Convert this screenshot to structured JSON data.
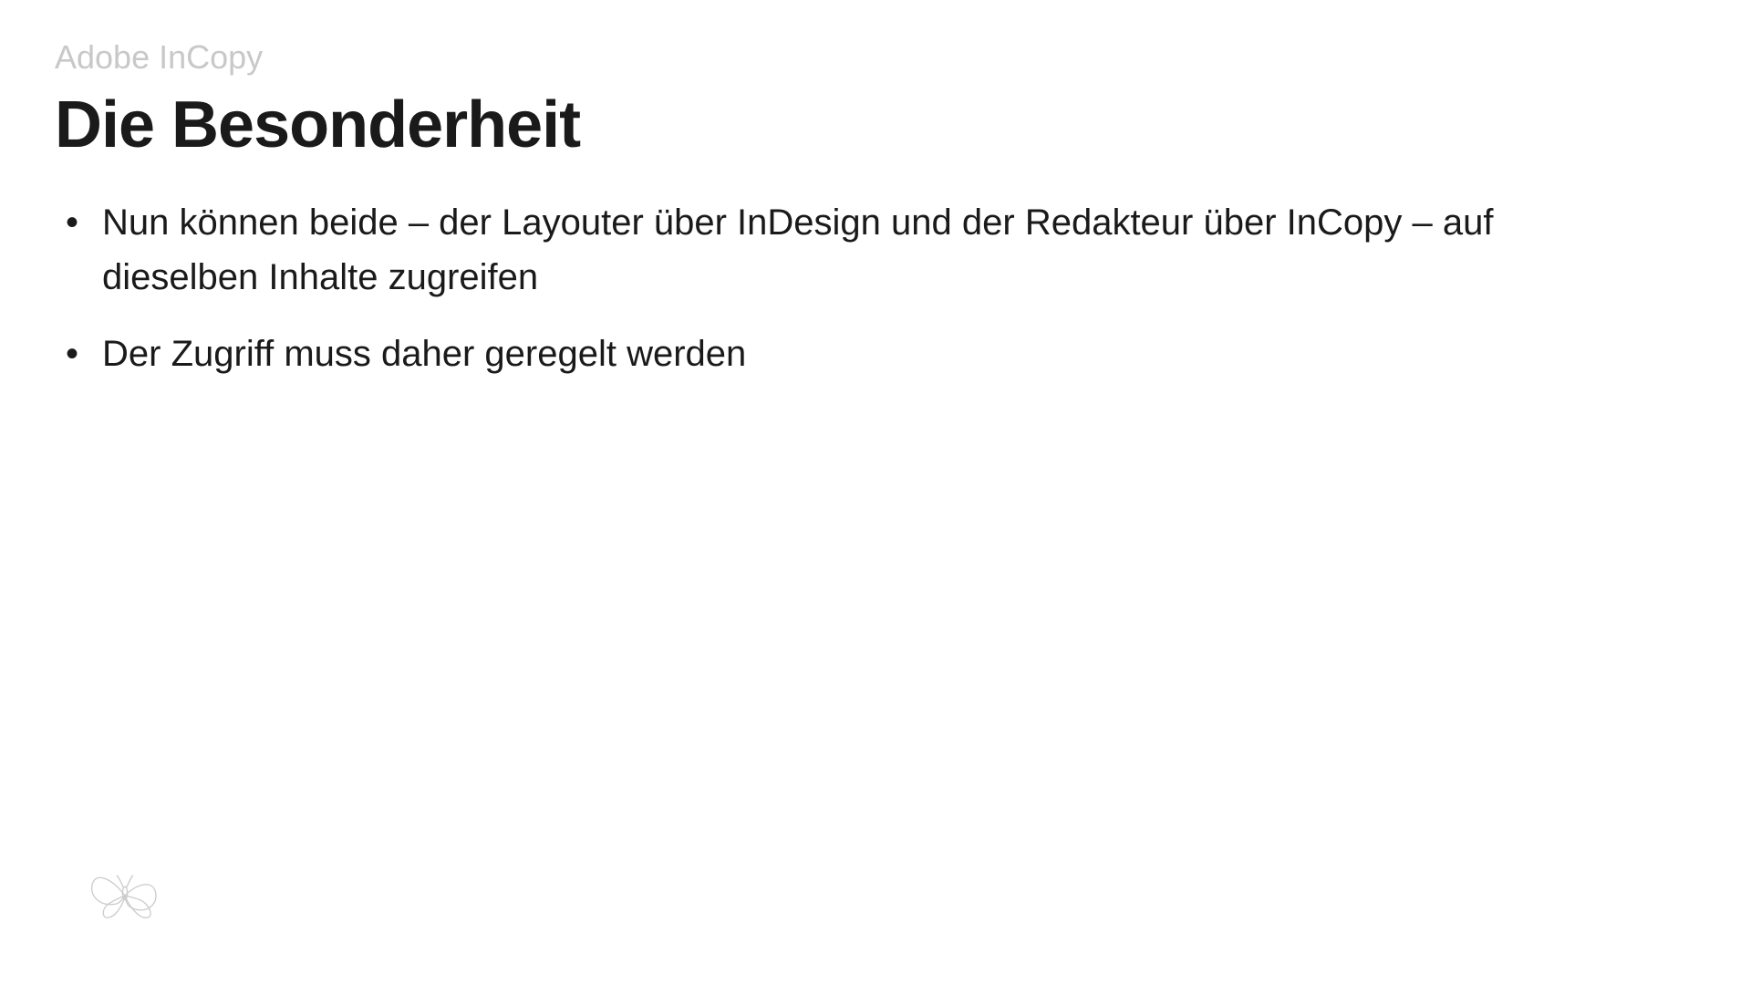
{
  "header": {
    "subtitle": "Adobe InCopy",
    "title": "Die Besonderheit"
  },
  "bullets": [
    "Nun können beide – der Layouter über InDesign und der Redakteur über InCopy – auf dieselben Inhalte zugreifen",
    "Der Zugriff muss daher geregelt werden"
  ]
}
